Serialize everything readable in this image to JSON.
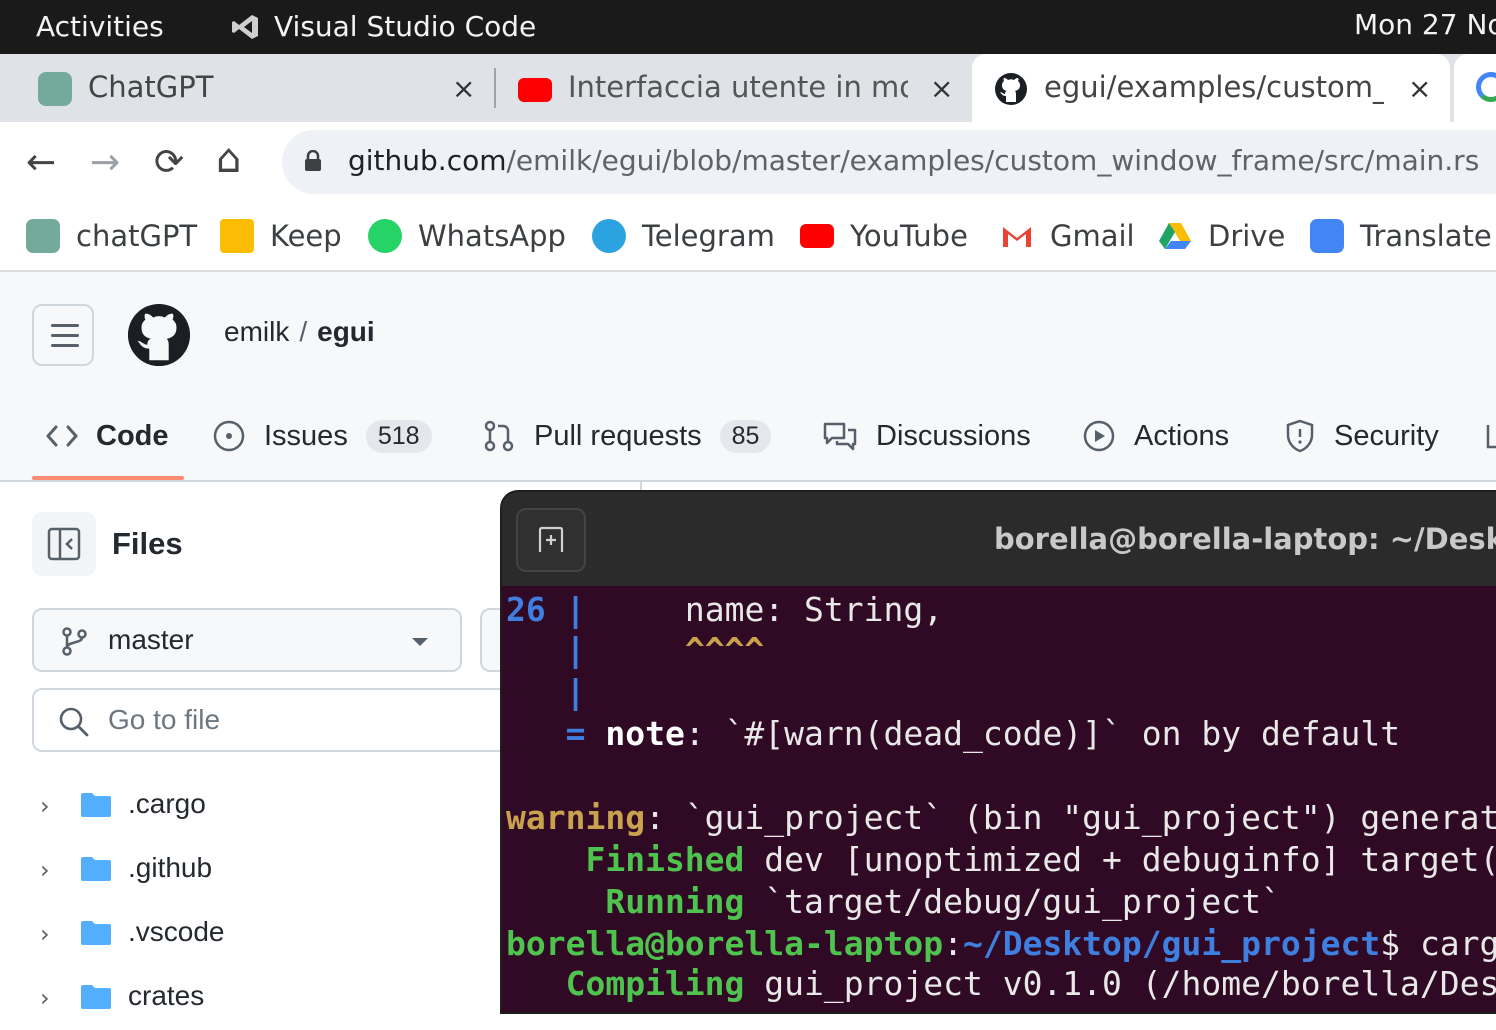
{
  "topbar": {
    "activities": "Activities",
    "app_name": "Visual Studio Code",
    "clock": "Mon 27 No"
  },
  "tabs": [
    {
      "title": "ChatGPT",
      "icon": "chatgpt-icon"
    },
    {
      "title": "Interfaccia utente in mod",
      "icon": "youtube-icon"
    },
    {
      "title": "egui/examples/custom_",
      "icon": "github-icon",
      "active": true
    },
    {
      "title": "",
      "icon": "google-icon"
    }
  ],
  "tab_close": "×",
  "omnibox": {
    "domain": "github.com",
    "path": "/emilk/egui/blob/master/examples/custom_window_frame/src/main.rs"
  },
  "nav": {
    "back": "←",
    "forward": "→",
    "reload": "⟳",
    "home": "⌂"
  },
  "bookmarks": [
    {
      "label": "chatGPT",
      "icon": "chatgpt-icon",
      "color": "#74aa9c"
    },
    {
      "label": "Keep",
      "icon": "keep-icon",
      "color": "#fbbc04"
    },
    {
      "label": "WhatsApp",
      "icon": "whatsapp-icon",
      "color": "#25d366"
    },
    {
      "label": "Telegram",
      "icon": "telegram-icon",
      "color": "#2aa3e0"
    },
    {
      "label": "YouTube",
      "icon": "youtube-icon",
      "color": "#ff0000"
    },
    {
      "label": "Gmail",
      "icon": "gmail-icon",
      "color": "#ea4335"
    },
    {
      "label": "Drive",
      "icon": "drive-icon",
      "color": "#1fa463"
    },
    {
      "label": "Translate",
      "icon": "translate-icon",
      "color": "#4285f4"
    }
  ],
  "github": {
    "owner": "emilk",
    "separator": "/",
    "repo": "egui",
    "nav": {
      "code": "Code",
      "issues": "Issues",
      "issues_count": "518",
      "pulls": "Pull requests",
      "pulls_count": "85",
      "discussions": "Discussions",
      "actions": "Actions",
      "security": "Security"
    },
    "files_title": "Files",
    "branch": "master",
    "goto_placeholder": "Go to file",
    "tree": [
      ".cargo",
      ".github",
      ".vscode",
      "crates"
    ]
  },
  "terminal": {
    "title": "borella@borella-laptop: ~/Desktop/g",
    "lines": {
      "l1_num": "26",
      "l1_bar": " |",
      "l1_code": "     name: String,",
      "l2_bar": "   |",
      "l2_carets": "     ^^^^",
      "l3_bar": "   |",
      "l4_eq": "   =",
      "l4_note": " note",
      "l4_rest": ": `#[warn(dead_code)]` on by default",
      "l5_warning": "warning",
      "l5_rest": ": `gui_project` (bin \"gui_project\") generat",
      "l6_label": "    Finished",
      "l6_rest": " dev [unoptimized + debuginfo] target(",
      "l7_label": "     Running",
      "l7_rest": " `target/debug/gui_project`",
      "l8_user": "borella@borella-laptop",
      "l8_colon": ":",
      "l8_path": "~/Desktop/gui_project",
      "l8_rest": "$ carg",
      "l9_label": "   Compiling",
      "l9_rest": " gui_project v0.1.0 (/home/borella/Des"
    }
  }
}
